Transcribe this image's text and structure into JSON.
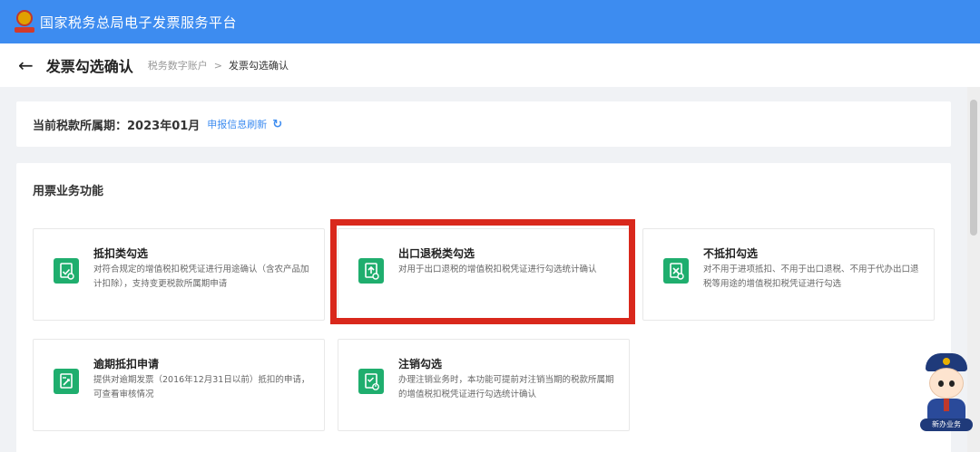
{
  "header": {
    "platform_title": "国家税务总局电子发票服务平台"
  },
  "subheader": {
    "back_icon": "←",
    "page_title": "发票勾选确认",
    "breadcrumb": [
      "税务数字账户",
      "发票勾选确认"
    ],
    "breadcrumb_separator": ">"
  },
  "period": {
    "label": "当前税款所属期：",
    "value": "2023年01月",
    "refresh_link": "申报信息刷新",
    "refresh_icon": "↻"
  },
  "functions": {
    "section_title": "用票业务功能",
    "items": [
      {
        "name": "抵扣类勾选",
        "desc": "对符合规定的增值税扣税凭证进行用途确认（含农产品加计扣除），支持变更税款所属期申请",
        "icon": "checkmark-document-icon"
      },
      {
        "name": "出口退税类勾选",
        "desc": "对用于出口退税的增值税扣税凭证进行勾选统计确认",
        "icon": "export-refund-icon"
      },
      {
        "name": "不抵扣勾选",
        "desc": "对不用于进项抵扣、不用于出口退税、不用于代办出口退税等用途的增值税扣税凭证进行勾选",
        "icon": "no-deduct-icon"
      },
      {
        "name": "逾期抵扣申请",
        "desc": "提供对逾期发票（2016年12月31日以前）抵扣的申请，可查看审核情况",
        "icon": "overdue-apply-icon"
      },
      {
        "name": "注销勾选",
        "desc": "办理注销业务时，本功能可提前对注销当期的税款所属期的增值税扣税凭证进行勾选统计确认",
        "icon": "cancel-power-icon"
      }
    ]
  },
  "assistant": {
    "label": "新办业务"
  },
  "colors": {
    "header_blue": "#3d8cf0",
    "tile_icon_green": "#1fae6e",
    "highlight_red": "#d9281c",
    "link_blue": "#3d8cf0"
  }
}
